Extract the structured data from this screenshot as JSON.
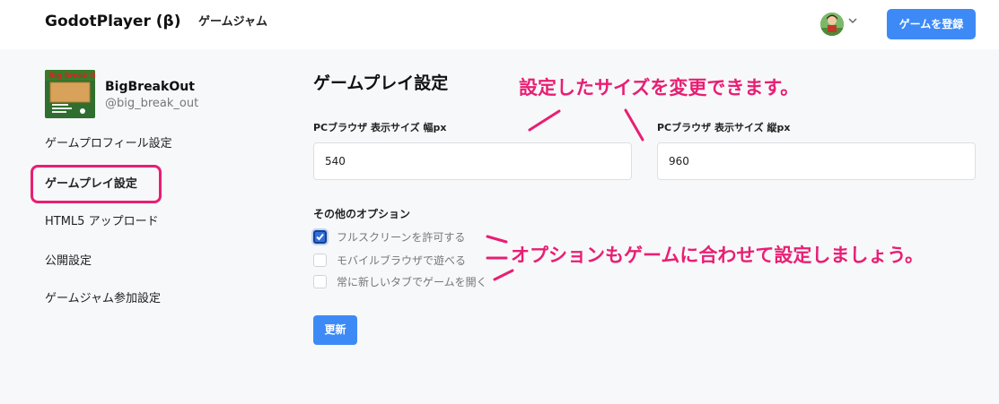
{
  "header": {
    "brand": "GodotPlayer (β)",
    "nav_game_jam": "ゲームジャム",
    "register_button": "ゲームを登録",
    "avatar_icon": "user-avatar-icon",
    "menu_icon": "chevron-down-icon"
  },
  "sidebar": {
    "game_name": "BigBreakOut",
    "game_handle": "@big_break_out",
    "thumbnail_text": "Big Break Out",
    "items": [
      {
        "label": "ゲームプロフィール設定"
      },
      {
        "label": "ゲームプレイ設定",
        "active": true
      },
      {
        "label": "HTML5 アップロード"
      },
      {
        "label": "公開設定"
      },
      {
        "label": "ゲームジャム参加設定"
      }
    ]
  },
  "main": {
    "title": "ゲームプレイ設定",
    "width_label": "PCブラウザ 表示サイズ 幅px",
    "width_value": "540",
    "height_label": "PCブラウザ 表示サイズ 縦px",
    "height_value": "960",
    "options_label": "その他のオプション",
    "options": [
      {
        "label": "フルスクリーンを許可する",
        "checked": true
      },
      {
        "label": "モバイルブラウザで遊べる",
        "checked": false
      },
      {
        "label": "常に新しいタブでゲームを開く",
        "checked": false
      }
    ],
    "update_button": "更新"
  },
  "annotations": {
    "size_note": "設定したサイズを変更できます。",
    "options_note": "オプションもゲームに合わせて設定しましょう。",
    "color": "#e91e73"
  },
  "colors": {
    "accent": "#3d8af7",
    "highlight": "#e91e73",
    "background": "#f7f8fa"
  }
}
